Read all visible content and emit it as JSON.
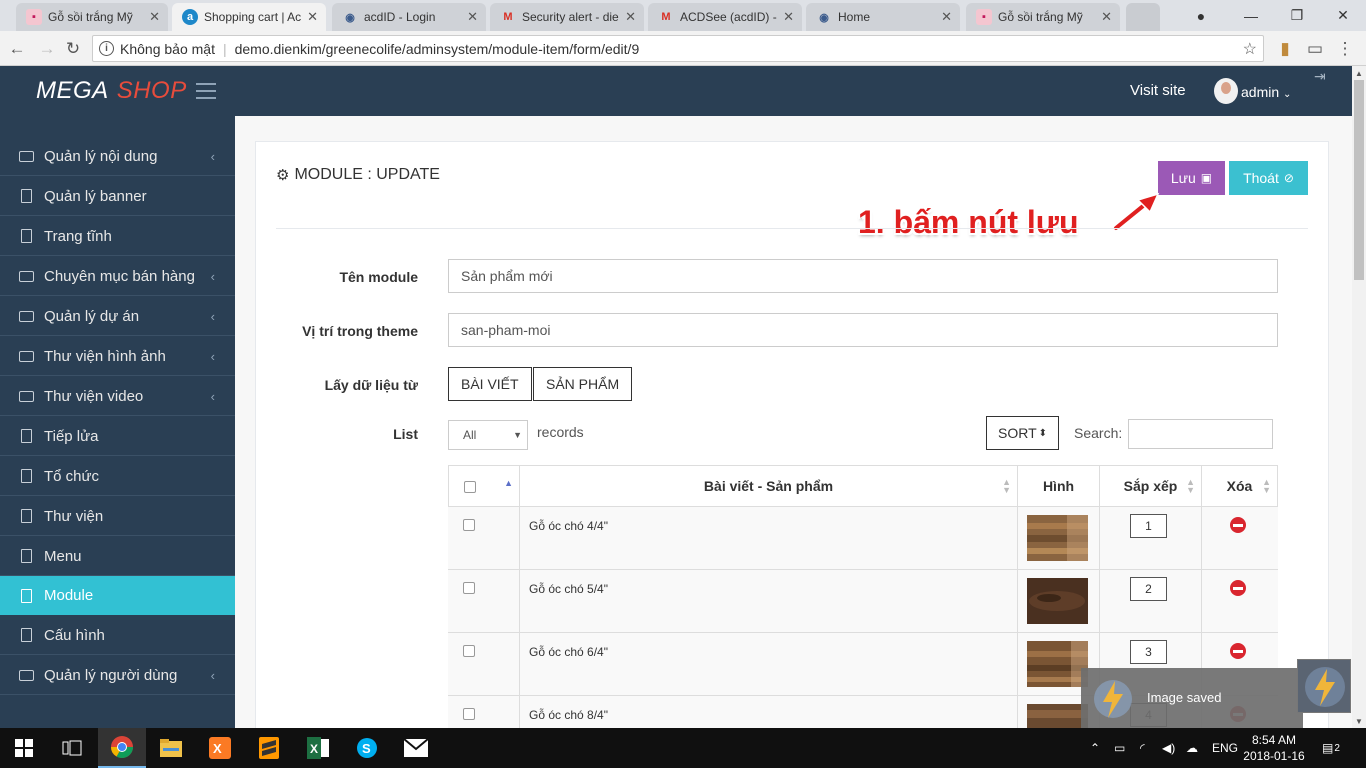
{
  "browser": {
    "tabs": [
      {
        "label": "Gỗ sồi trắng Mỹ",
        "favicon": "pink-site-icon",
        "active": false
      },
      {
        "label": "Shopping cart | Ac",
        "favicon": "a-letter-icon",
        "active": true
      },
      {
        "label": "acdID - Login",
        "favicon": "eye-icon",
        "active": false
      },
      {
        "label": "Security alert - die",
        "favicon": "gmail-icon",
        "active": false
      },
      {
        "label": "ACDSee (acdID) - ",
        "favicon": "gmail-icon",
        "active": false
      },
      {
        "label": "Home",
        "favicon": "eye-icon",
        "active": false
      },
      {
        "label": "Gỗ sồi trắng Mỹ",
        "favicon": "pink-site-icon",
        "active": false
      }
    ],
    "security_label": "Không bảo mật",
    "url": "demo.dienkim/greenecolife/adminsystem/module-item/form/edit/9"
  },
  "header": {
    "logo_mega": "MEGA",
    "logo_shop": "SHOP",
    "visit_site": "Visit site",
    "user": "admin"
  },
  "sidebar": {
    "items": [
      {
        "label": "Quản lý nội dung",
        "icon": "folder-icon",
        "submenu": true,
        "active": false
      },
      {
        "label": "Quản lý banner",
        "icon": "book-icon",
        "submenu": false,
        "active": false
      },
      {
        "label": "Trang tĩnh",
        "icon": "book-icon",
        "submenu": false,
        "active": false
      },
      {
        "label": "Chuyên mục bán hàng",
        "icon": "folder-icon",
        "submenu": true,
        "active": false
      },
      {
        "label": "Quản lý dự án",
        "icon": "folder-icon",
        "submenu": true,
        "active": false
      },
      {
        "label": "Thư viện hình ảnh",
        "icon": "folder-icon",
        "submenu": true,
        "active": false
      },
      {
        "label": "Thư viện video",
        "icon": "folder-icon",
        "submenu": true,
        "active": false
      },
      {
        "label": "Tiếp lửa",
        "icon": "book-icon",
        "submenu": false,
        "active": false
      },
      {
        "label": "Tổ chức",
        "icon": "book-icon",
        "submenu": false,
        "active": false
      },
      {
        "label": "Thư viện",
        "icon": "book-icon",
        "submenu": false,
        "active": false
      },
      {
        "label": "Menu",
        "icon": "book-icon",
        "submenu": false,
        "active": false
      },
      {
        "label": "Module",
        "icon": "book-icon",
        "submenu": false,
        "active": true
      },
      {
        "label": "Cấu hình",
        "icon": "book-icon",
        "submenu": false,
        "active": false
      },
      {
        "label": "Quản lý người dùng",
        "icon": "folder-icon",
        "submenu": true,
        "active": false
      }
    ]
  },
  "panel": {
    "title": "MODULE : UPDATE",
    "save_label": "Lưu",
    "exit_label": "Thoát",
    "annotation": "1. bấm nút lưu",
    "fields": {
      "name_label": "Tên module",
      "name_value": "Sản phẩm mới",
      "position_label": "Vị trí trong theme",
      "position_value": "san-pham-moi",
      "source_label": "Lấy dữ liệu từ",
      "source_options": [
        "BÀI VIẾT",
        "SẢN PHẨM"
      ],
      "list_label": "List"
    },
    "list_select": "All",
    "records_label": "records",
    "sort_label": "SORT",
    "search_label": "Search:",
    "search_value": ""
  },
  "table": {
    "headers": {
      "name": "Bài viết - Sản phẩm",
      "image": "Hình",
      "order": "Sắp xếp",
      "delete": "Xóa"
    },
    "rows": [
      {
        "name": "Gỗ óc chó 4/4\"",
        "order": "1"
      },
      {
        "name": "Gỗ óc chó 5/4\"",
        "order": "2"
      },
      {
        "name": "Gỗ óc chó 6/4\"",
        "order": "3"
      },
      {
        "name": "Gỗ óc chó 8/4\"",
        "order": "4"
      }
    ]
  },
  "toast": {
    "message": "Image saved"
  },
  "taskbar": {
    "language": "ENG",
    "time": "8:54 AM",
    "date": "2018-01-16",
    "notifications": "2"
  },
  "colors": {
    "sidebar_bg": "#2a3f54",
    "active_item": "#32c1d3",
    "save_button": "#9b59b6",
    "exit_button": "#3bc0d0",
    "annotation": "#e02020",
    "delete_icon": "#d9262f"
  }
}
